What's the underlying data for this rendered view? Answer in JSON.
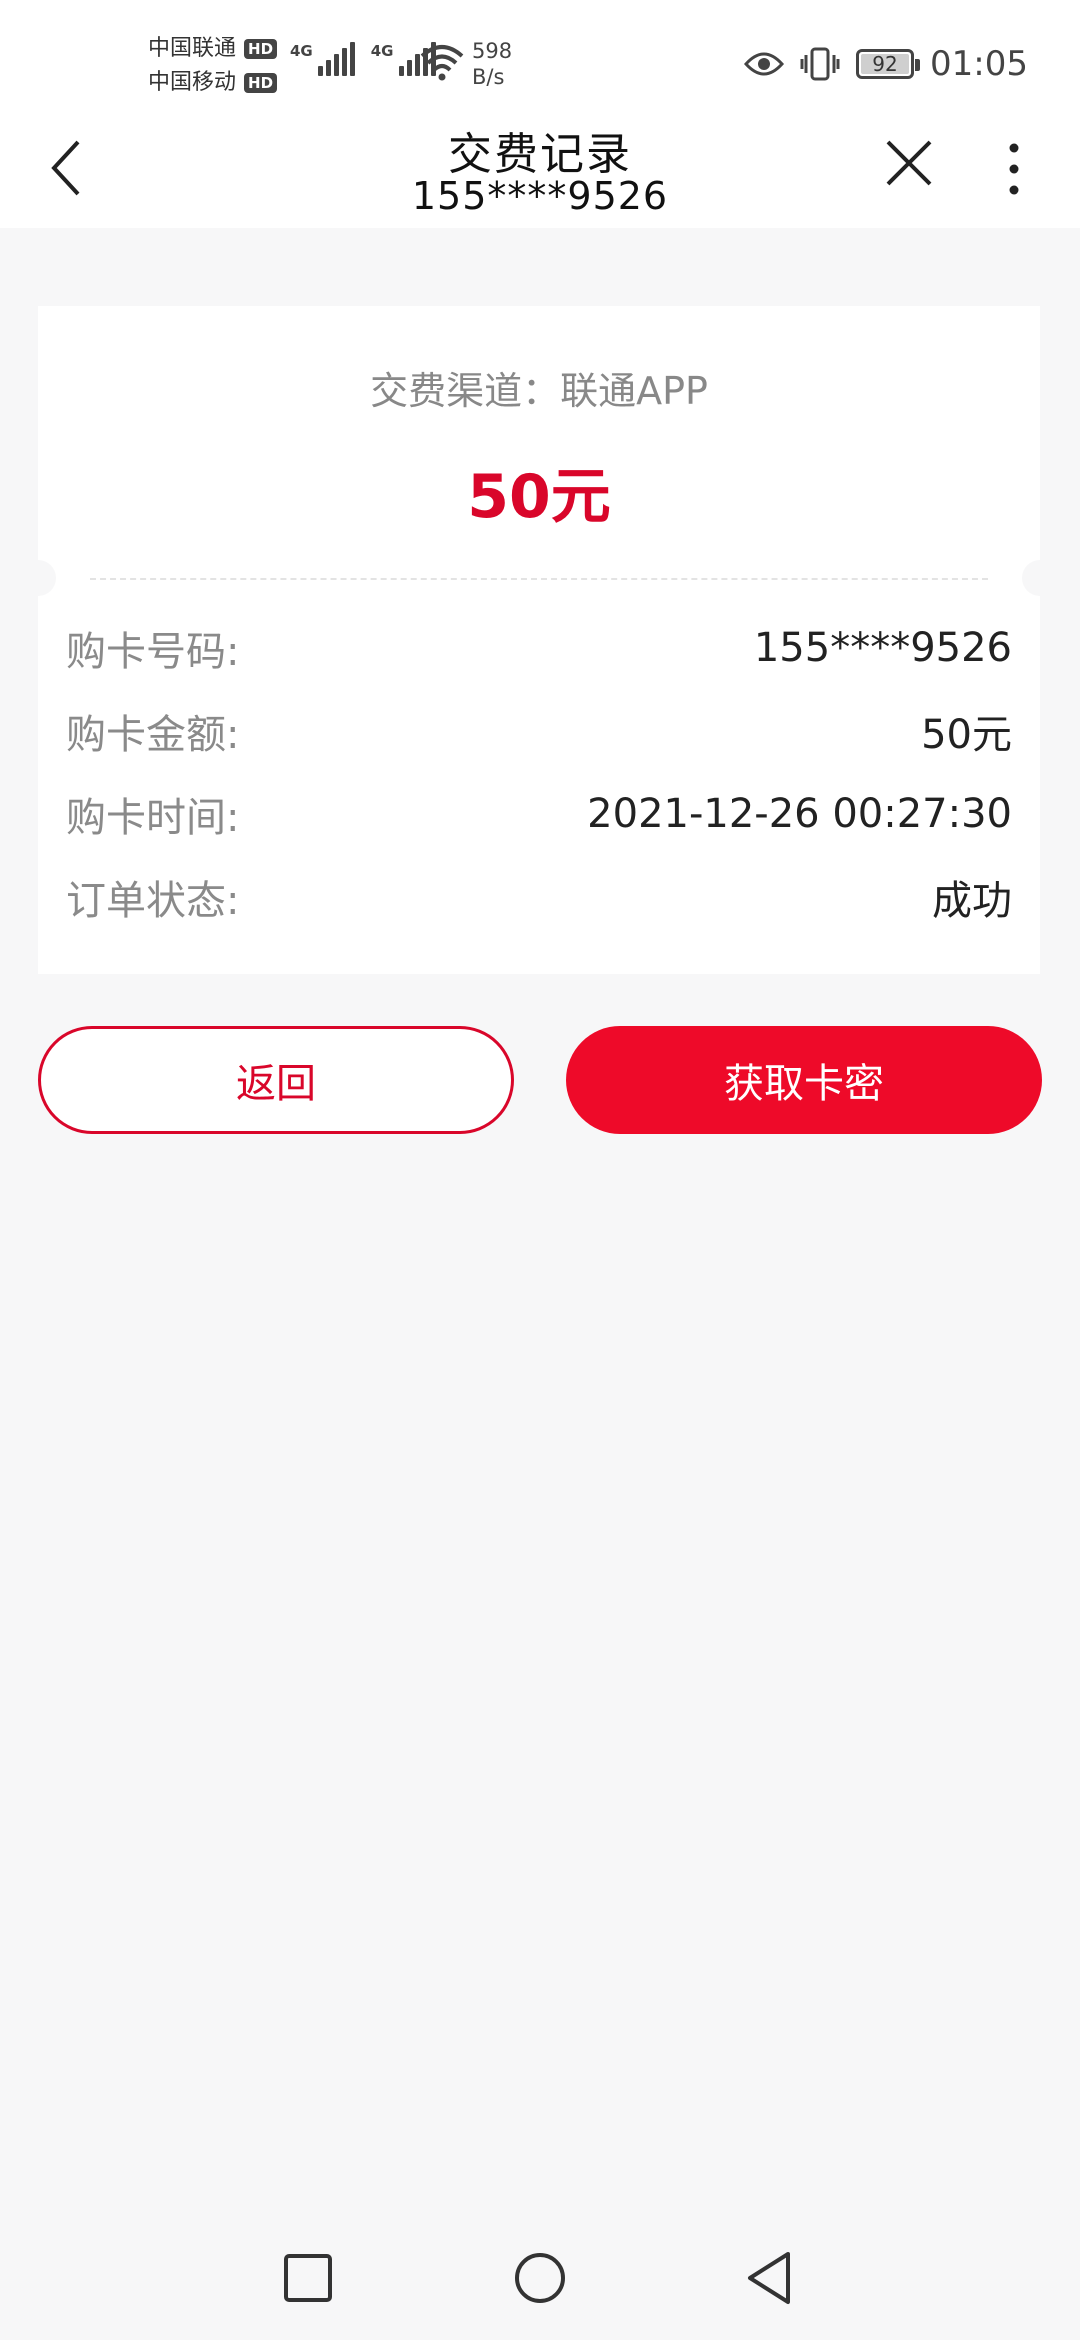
{
  "status_bar": {
    "carrier1": "中国联通",
    "carrier2": "中国移动",
    "hd_badge": "HD",
    "network_tag": "4G",
    "net_speed_value": "598",
    "net_speed_unit": "B/s",
    "battery_level": "92",
    "battery_fraction": 0.92,
    "time": "01:05",
    "icons": [
      "eye-icon",
      "vibrate-icon",
      "wifi-icon",
      "signal-icon",
      "battery-icon"
    ]
  },
  "header": {
    "title": "交费记录",
    "subtitle": "155****9526",
    "icons": [
      "back-arrow-icon",
      "close-icon",
      "more-icon"
    ]
  },
  "card": {
    "channel_text": "交费渠道：联通APP",
    "amount": "50元",
    "rows": [
      {
        "label": "购卡号码:",
        "value": "155****9526"
      },
      {
        "label": "购卡金额:",
        "value": "50元"
      },
      {
        "label": "购卡时间:",
        "value": "2021-12-26 00:27:30"
      },
      {
        "label": "订单状态:",
        "value": "成功"
      }
    ]
  },
  "buttons": {
    "back_label": "返回",
    "get_card_label": "获取卡密"
  },
  "colors": {
    "accent": "#ee0a29",
    "amount": "#d9062a",
    "background": "#f7f7f8"
  },
  "nav_bar": {
    "icons": [
      "recent-apps-icon",
      "home-icon",
      "back-triangle-icon"
    ]
  }
}
